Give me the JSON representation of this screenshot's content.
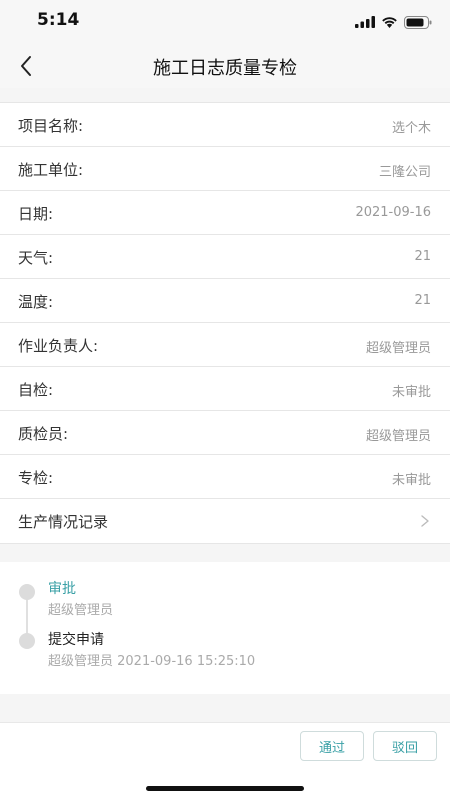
{
  "status_bar": {
    "time": "5:14"
  },
  "nav": {
    "title": "施工日志质量专检",
    "back_icon": "chevron-left-icon"
  },
  "info_rows": [
    {
      "label": "项目名称:",
      "value": "选个木"
    },
    {
      "label": "施工单位:",
      "value": "三隆公司"
    },
    {
      "label": "日期:",
      "value": "2021-09-16"
    },
    {
      "label": "天气:",
      "value": "21"
    },
    {
      "label": "温度:",
      "value": "21"
    },
    {
      "label": "作业负责人:",
      "value": "超级管理员"
    },
    {
      "label": "自检:",
      "value": "未审批"
    },
    {
      "label": "质检员:",
      "value": "超级管理员"
    },
    {
      "label": "专检:",
      "value": "未审批"
    }
  ],
  "production_record": {
    "label": "生产情况记录",
    "icon": "chevron-right-icon"
  },
  "timeline": [
    {
      "title": "审批",
      "subtitle": "超级管理员",
      "title_color": "#3aa0a6"
    },
    {
      "title": "提交申请",
      "subtitle": "超级管理员 2021-09-16 15:25:10",
      "title_color": "#222222"
    }
  ],
  "actions": {
    "approve_label": "通过",
    "reject_label": "驳回"
  },
  "colors": {
    "accent": "#3aa0a6"
  }
}
